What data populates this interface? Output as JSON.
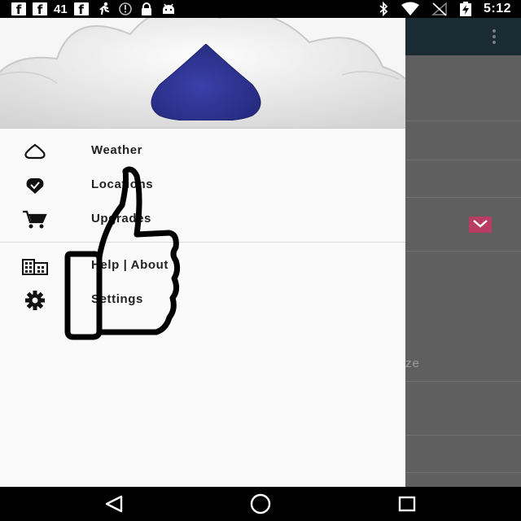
{
  "status_bar": {
    "notification_icons": [
      "facebook-icon",
      "facebook-icon"
    ],
    "notification_count": "41",
    "extra_icons": [
      "facebook-icon",
      "running-man-icon",
      "info-circle-icon",
      "lock-icon",
      "android-icon"
    ],
    "right_icons": [
      "bluetooth-icon",
      "wifi-icon",
      "signal-off-icon",
      "battery-charging-icon"
    ],
    "time": "5:12"
  },
  "drawer": {
    "header_icon": "water-drop-icon",
    "items": [
      {
        "label": "Weather",
        "icon": "drop-outline-icon"
      },
      {
        "label": "Locations",
        "icon": "location-pin-icon"
      },
      {
        "label": "Upgrades",
        "icon": "shopping-cart-icon"
      },
      {
        "label": "Help | About",
        "icon": "building-icon"
      },
      {
        "label": "Settings",
        "icon": "gear-icon"
      }
    ]
  },
  "background_app": {
    "partial_text": "ze"
  },
  "overlay": {
    "gesture": "thumbs-up-hand-drawing"
  },
  "nav_bar": {
    "buttons": [
      "back-icon",
      "home-icon",
      "recents-icon"
    ]
  },
  "colors": {
    "drop_blue": "#2f3593",
    "toolbar": "#1b2b33",
    "check_accent": "#b83c64"
  }
}
